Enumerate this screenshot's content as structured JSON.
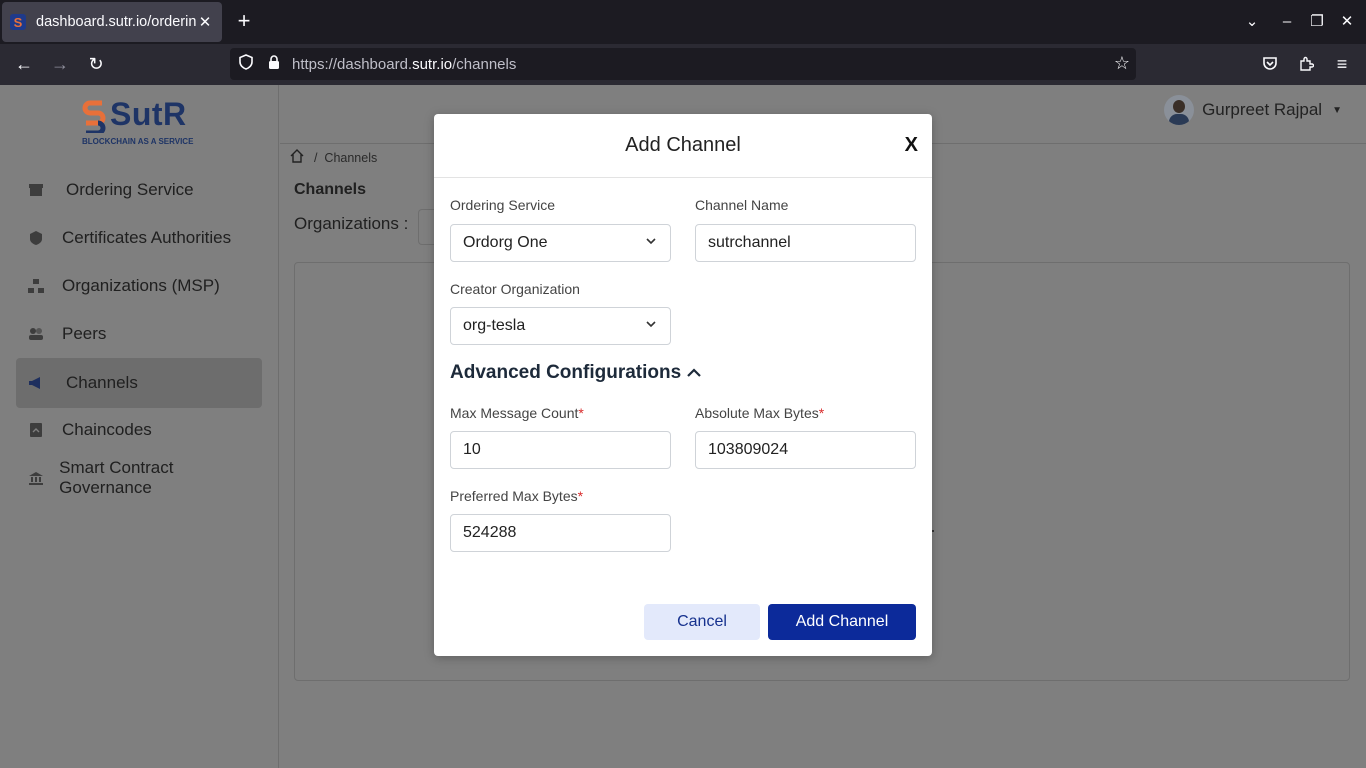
{
  "browser": {
    "tab_title": "dashboard.sutr.io/ordering",
    "url_prefix": "https://dashboard.",
    "url_domain": "sutr.io",
    "url_path": "/channels"
  },
  "app": {
    "logo_text": "SutR",
    "logo_tagline": "BLOCKCHAIN AS A SERVICE",
    "user_name": "Gurpreet Rajpal",
    "breadcrumb_current": "Channels",
    "page_title": "Channels",
    "organizations_label": "Organizations :"
  },
  "sidebar": {
    "items": [
      {
        "label": "Ordering Service",
        "icon": "box-icon"
      },
      {
        "label": "Certificates Authorities",
        "icon": "badge-icon"
      },
      {
        "label": "Organizations (MSP)",
        "icon": "hierarchy-icon"
      },
      {
        "label": "Peers",
        "icon": "people-icon"
      },
      {
        "label": "Channels",
        "icon": "megaphone-icon",
        "active": true
      },
      {
        "label": "Chaincodes",
        "icon": "code-file-icon"
      },
      {
        "label": "Smart Contract Governance",
        "icon": "bank-icon"
      }
    ]
  },
  "modal": {
    "title": "Add Channel",
    "close": "X",
    "ordering_service_label": "Ordering Service",
    "ordering_service_value": "Ordorg One",
    "channel_name_label": "Channel Name",
    "channel_name_value": "sutrchannel",
    "creator_org_label": "Creator Organization",
    "creator_org_value": "org-tesla",
    "advanced_title": "Advanced Configurations",
    "max_message_count_label": "Max Message Count",
    "max_message_count_value": "10",
    "absolute_max_bytes_label": "Absolute Max Bytes",
    "absolute_max_bytes_value": "103809024",
    "preferred_max_bytes_label": "Preferred Max Bytes",
    "preferred_max_bytes_value": "524288",
    "required_mark": "*",
    "cancel_label": "Cancel",
    "add_label": "Add Channel"
  },
  "colors": {
    "primary": "#0c2a9a",
    "cancel_bg": "#e3e9fb",
    "required": "#d92b2b",
    "overlay": "#7f7f7f"
  }
}
